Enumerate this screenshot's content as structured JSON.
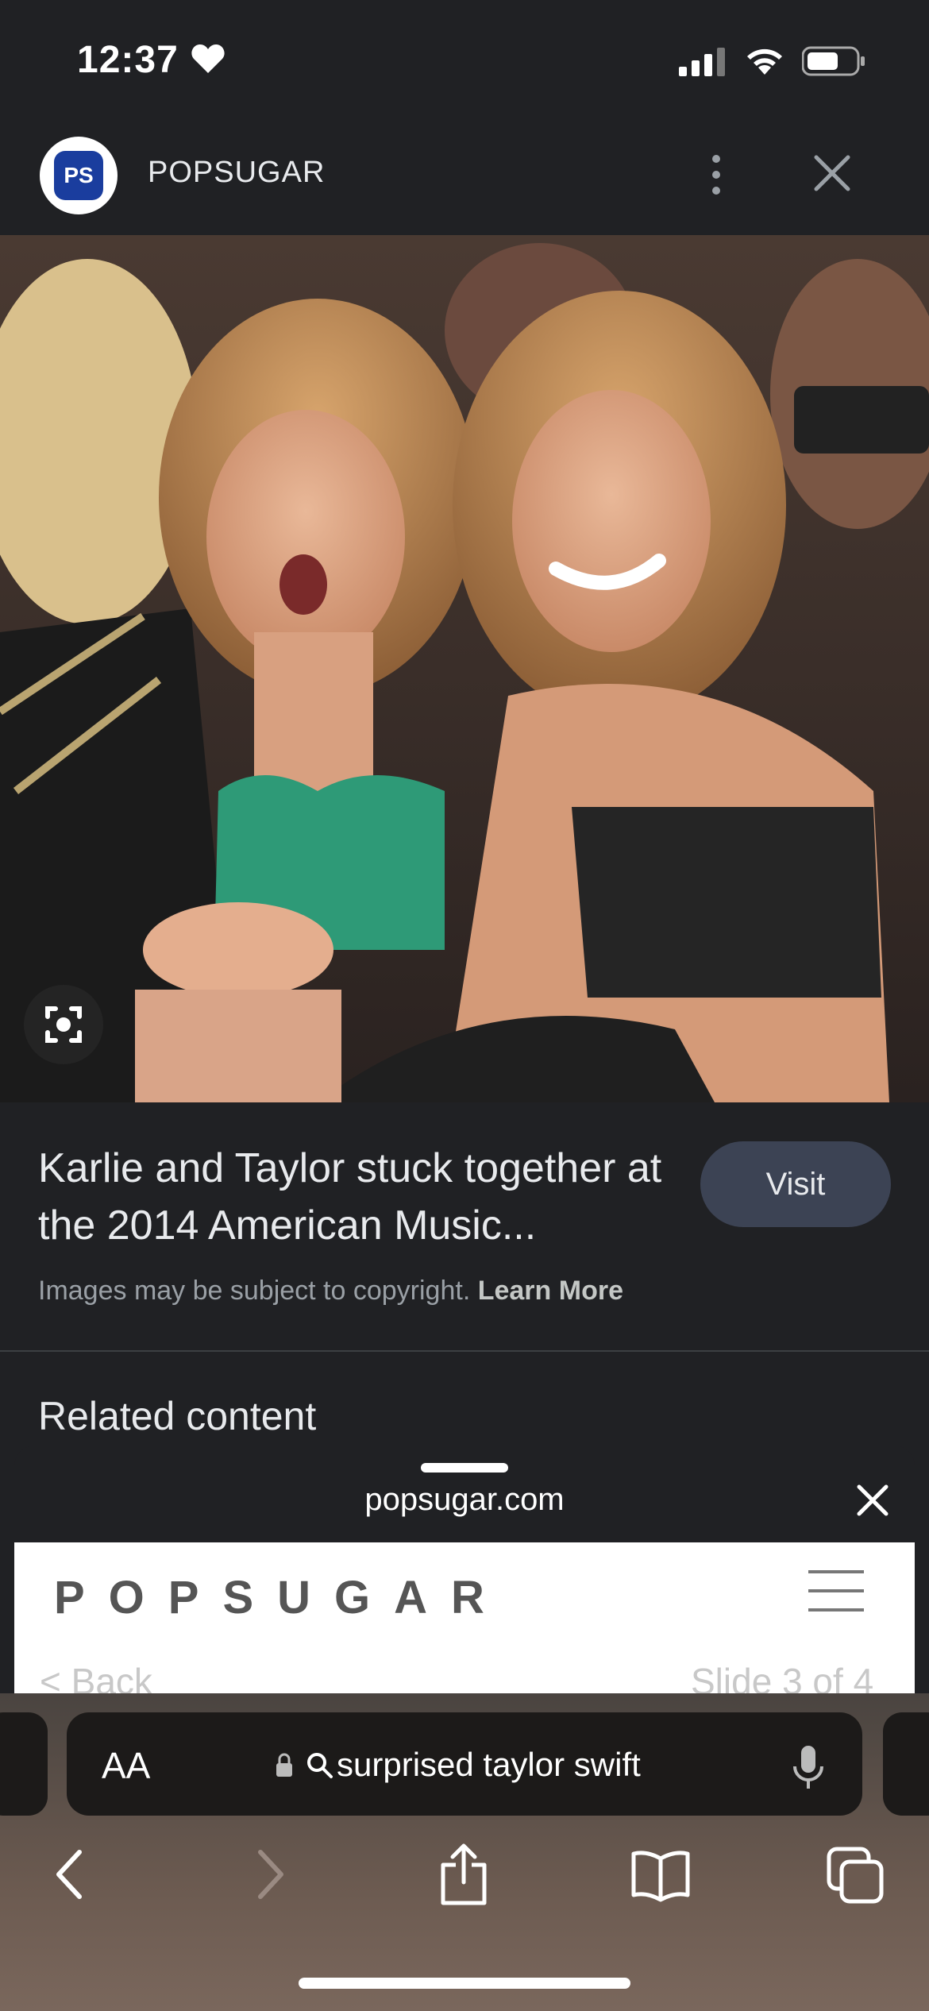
{
  "status_bar": {
    "time": "12:37"
  },
  "site": {
    "name": "POPSUGAR",
    "logo_text": "PS"
  },
  "result": {
    "caption": "Karlie and Taylor stuck together at the 2014 American Music...",
    "visit_label": "Visit",
    "copyright_text": "Images may be subject to copyright.",
    "learn_more": "Learn More",
    "related_heading": "Related content"
  },
  "sheet": {
    "url": "popsugar.com",
    "page_logo": "POPSUGAR",
    "back_text": "< Back",
    "slide_text": "Slide 3 of 4"
  },
  "browser": {
    "text_size_label": "AA",
    "address_text": "surprised taylor swift"
  },
  "icons": {
    "status": [
      "heart-icon",
      "signal-icon",
      "wifi-icon",
      "battery-icon"
    ],
    "toolbar": [
      "back-icon",
      "forward-icon",
      "share-icon",
      "bookmarks-icon",
      "tabs-icon"
    ]
  },
  "colors": {
    "background": "#202124",
    "visit_button": "#3c4354",
    "logo_blue": "#1a3d9e"
  }
}
